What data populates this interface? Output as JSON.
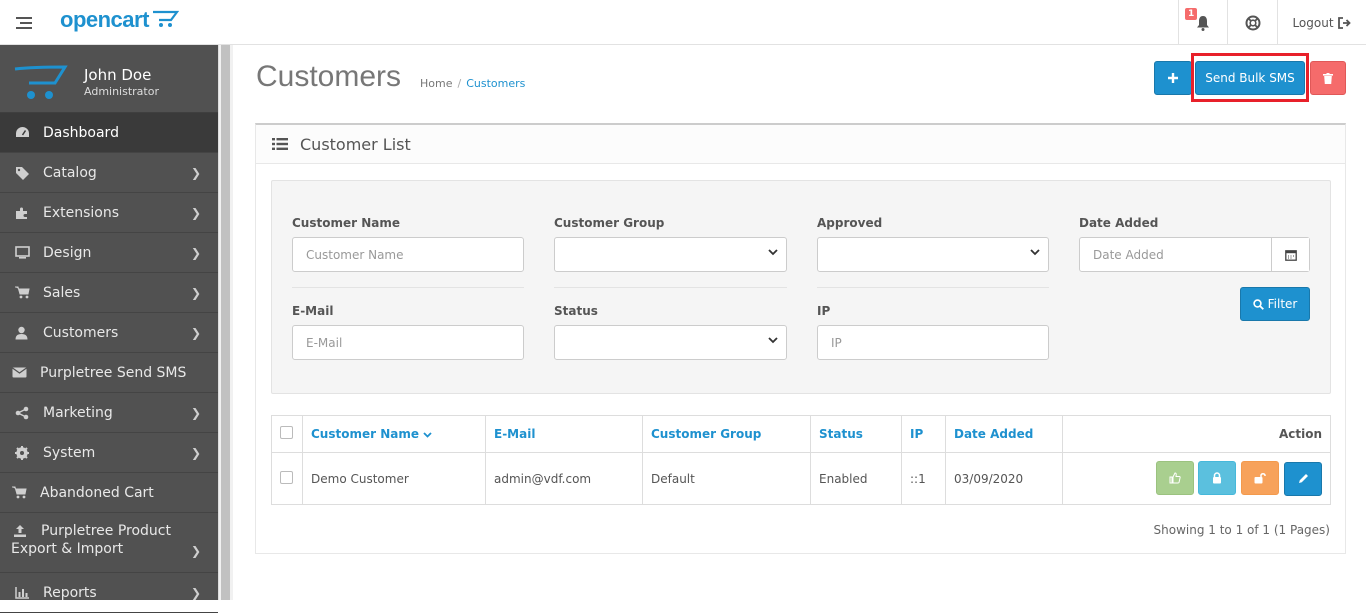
{
  "header": {
    "logo_text": "opencart",
    "notification_count": "1",
    "logout_label": "Logout"
  },
  "profile": {
    "name": "John Doe",
    "role": "Administrator"
  },
  "sidebar": {
    "items": [
      {
        "label": "Dashboard",
        "icon": "dashboard-icon"
      },
      {
        "label": "Catalog",
        "icon": "tags-icon"
      },
      {
        "label": "Extensions",
        "icon": "puzzle-icon"
      },
      {
        "label": "Design",
        "icon": "monitor-icon"
      },
      {
        "label": "Sales",
        "icon": "cart-icon"
      },
      {
        "label": "Customers",
        "icon": "user-icon"
      },
      {
        "label": "Purpletree Send SMS",
        "icon": "envelope-icon"
      },
      {
        "label": "Marketing",
        "icon": "share-icon"
      },
      {
        "label": "System",
        "icon": "cog-icon"
      },
      {
        "label": "Abandoned Cart",
        "icon": "cart-icon"
      },
      {
        "label_line1": "Purpletree Product",
        "label_line2": "Export & Import",
        "icon": "upload-icon"
      },
      {
        "label": "Reports",
        "icon": "bar-chart-icon"
      }
    ]
  },
  "page": {
    "title": "Customers",
    "breadcrumb": [
      "Home",
      "/",
      "Customers"
    ],
    "send_bulk_sms_label": "Send Bulk SMS"
  },
  "panel": {
    "title": "Customer List",
    "filter": {
      "customer_name_label": "Customer Name",
      "customer_name_placeholder": "Customer Name",
      "customer_group_label": "Customer Group",
      "approved_label": "Approved",
      "date_added_label": "Date Added",
      "date_added_placeholder": "Date Added",
      "email_label": "E-Mail",
      "email_placeholder": "E-Mail",
      "status_label": "Status",
      "ip_label": "IP",
      "ip_placeholder": "IP",
      "filter_button": "Filter"
    },
    "table": {
      "headers": [
        "Customer Name",
        "E-Mail",
        "Customer Group",
        "Status",
        "IP",
        "Date Added",
        "Action"
      ],
      "rows": [
        [
          "Demo Customer",
          "admin@vdf.com",
          "Default",
          "Enabled",
          "::1",
          "03/09/2020"
        ]
      ]
    },
    "pagination_info": "Showing 1 to 1 of 1 (1 Pages)"
  },
  "colors": {
    "primary": "#1e91cf",
    "danger": "#f56b6b",
    "success": "#8fbb6c",
    "info": "#5bc0de",
    "warning": "#f7a25b",
    "sidebar_bg": "#515151",
    "highlight": "#e8202a"
  }
}
